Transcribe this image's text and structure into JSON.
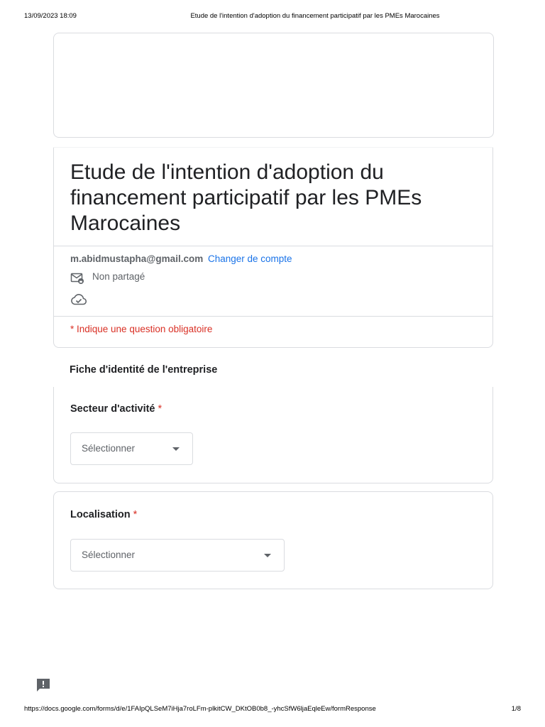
{
  "print_header": {
    "datetime": "13/09/2023 18:09",
    "doc_title": "Etude de l'intention d'adoption du financement participatif par les PMEs Marocaines"
  },
  "form": {
    "title": "Etude de l'intention d'adoption du financement participatif par les PMEs Marocaines",
    "account_email": "m.abidmustapha@gmail.com",
    "switch_account": "Changer de compte",
    "not_shared": "Non partagé",
    "required_note": "* Indique une question obligatoire"
  },
  "section": {
    "title": "Fiche d'identité de l'entreprise"
  },
  "questions": [
    {
      "label": "Secteur d'activité",
      "required_mark": "*",
      "selected": "Sélectionner"
    },
    {
      "label": "Localisation",
      "required_mark": "*",
      "selected": "Sélectionner"
    }
  ],
  "print_footer": {
    "url": "https://docs.google.com/forms/d/e/1FAIpQLSeM7iHja7roLFm-plkitCW_DKtOB0b8_-yhcSfW6ljaEqleEw/formResponse",
    "page": "1/8"
  },
  "colors": {
    "accent_link": "#1a73e8",
    "required_red": "#d93025",
    "border": "#dadce0",
    "muted_text": "#5f6368"
  },
  "icons": {
    "not_shared": "mail-lock-icon",
    "saved": "cloud-check-icon",
    "feedback": "feedback-icon",
    "dropdown": "caret-down-icon"
  }
}
